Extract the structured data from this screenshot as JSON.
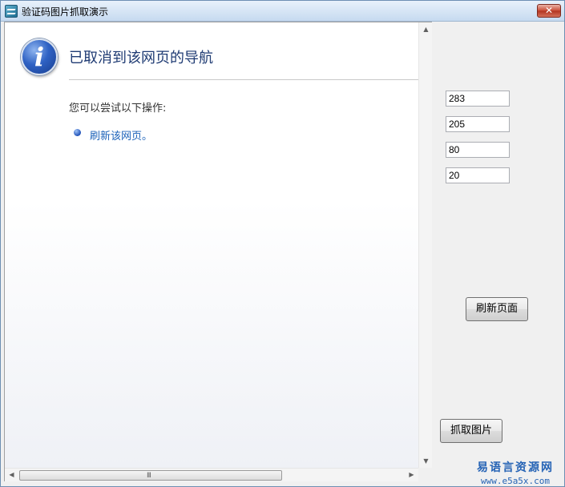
{
  "window": {
    "title": "验证码图片抓取演示",
    "close_label": "✕"
  },
  "browser": {
    "heading": "已取消到该网页的导航",
    "subtext": "您可以尝试以下操作:",
    "refresh_link": "刷新该网页。",
    "hscroll_grip": "III",
    "arrow_up": "▲",
    "arrow_down": "▼",
    "arrow_left": "◀",
    "arrow_right": "▶"
  },
  "fields": [
    "283",
    "205",
    "80",
    "20"
  ],
  "buttons": {
    "refresh_page": "刷新页面",
    "capture_image": "抓取图片"
  },
  "watermark": {
    "text": "易语言资源网",
    "url": "www.e5a5x.com"
  },
  "colors": {
    "heading": "#1f3b73",
    "link": "#1c62b9",
    "watermark": "#2563b5"
  },
  "icons": {
    "info": "i"
  }
}
